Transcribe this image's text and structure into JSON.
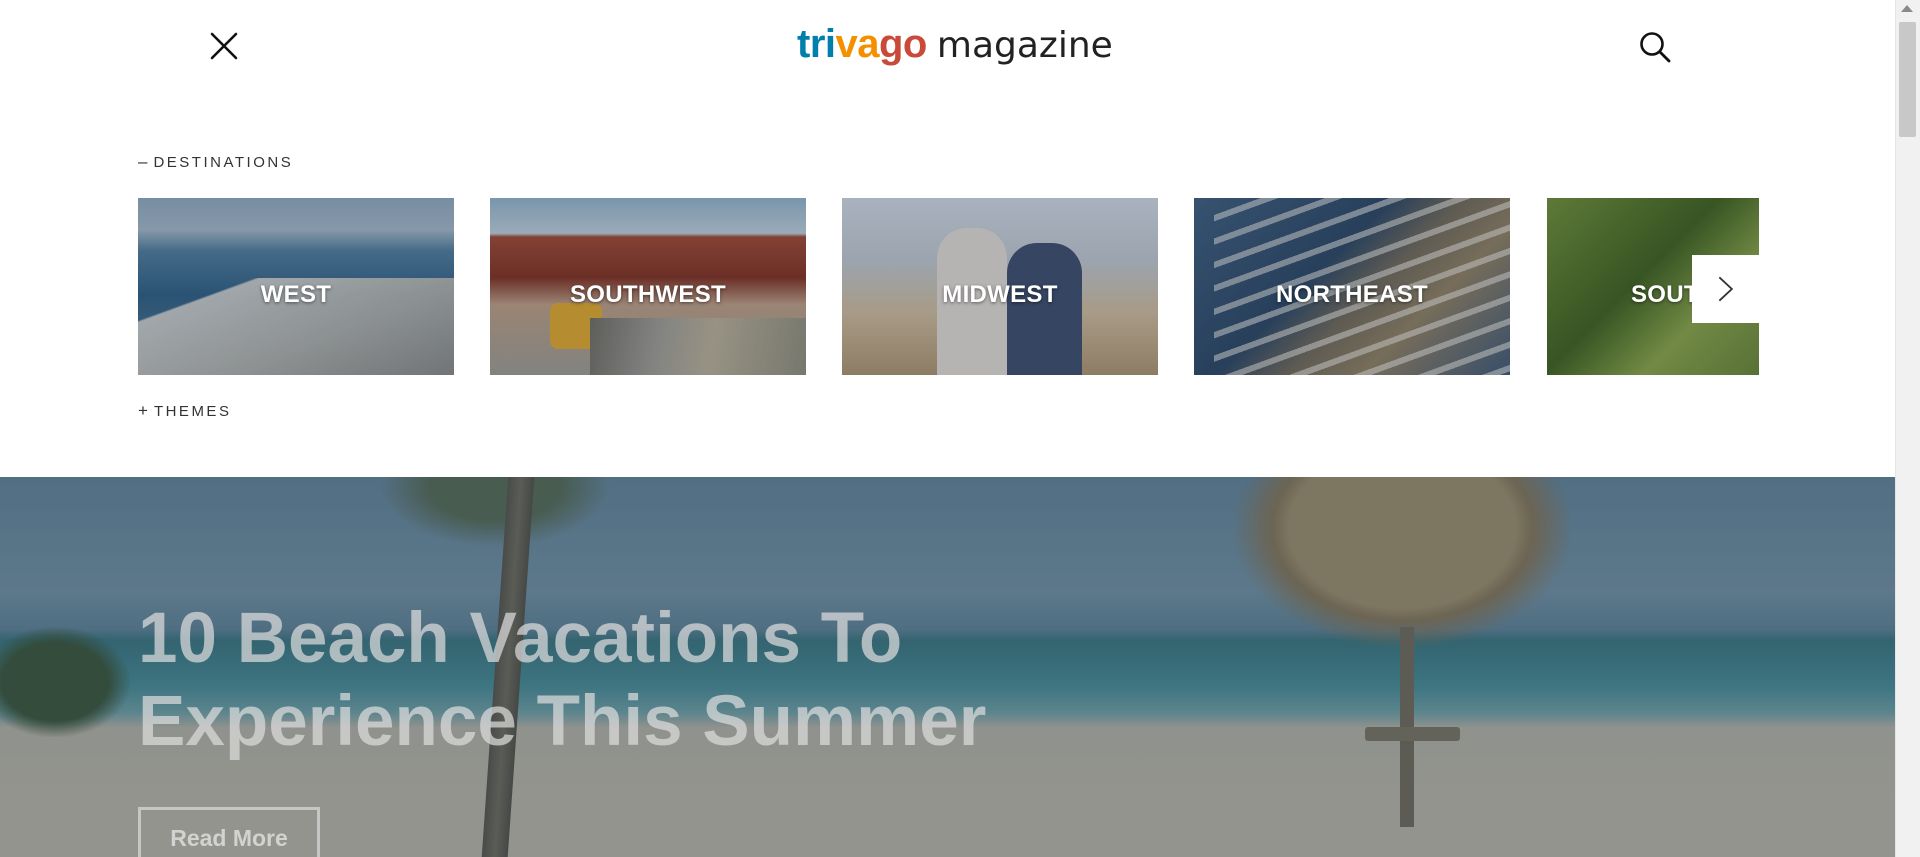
{
  "header": {
    "logo_brand_part1": "tri",
    "logo_brand_part2": "va",
    "logo_brand_part3": "go",
    "logo_suffix": "magazine",
    "close_icon": "close-icon",
    "search_icon": "search-icon",
    "colors": {
      "blue": "#007fad",
      "orange": "#f48f00",
      "red": "#c94a38"
    }
  },
  "menu": {
    "destinations": {
      "symbol": "–",
      "label": "DESTINATIONS"
    },
    "themes": {
      "symbol": "+",
      "label": "THEMES"
    }
  },
  "carousel": {
    "cards": [
      {
        "label": "WEST"
      },
      {
        "label": "SOUTHWEST"
      },
      {
        "label": "MIDWEST"
      },
      {
        "label": "NORTHEAST"
      },
      {
        "label": "SOUT"
      }
    ],
    "next_icon": "chevron-right-icon"
  },
  "hero": {
    "title": "10 Beach Vacations To Experience This Summer",
    "button_label": "Read More"
  }
}
